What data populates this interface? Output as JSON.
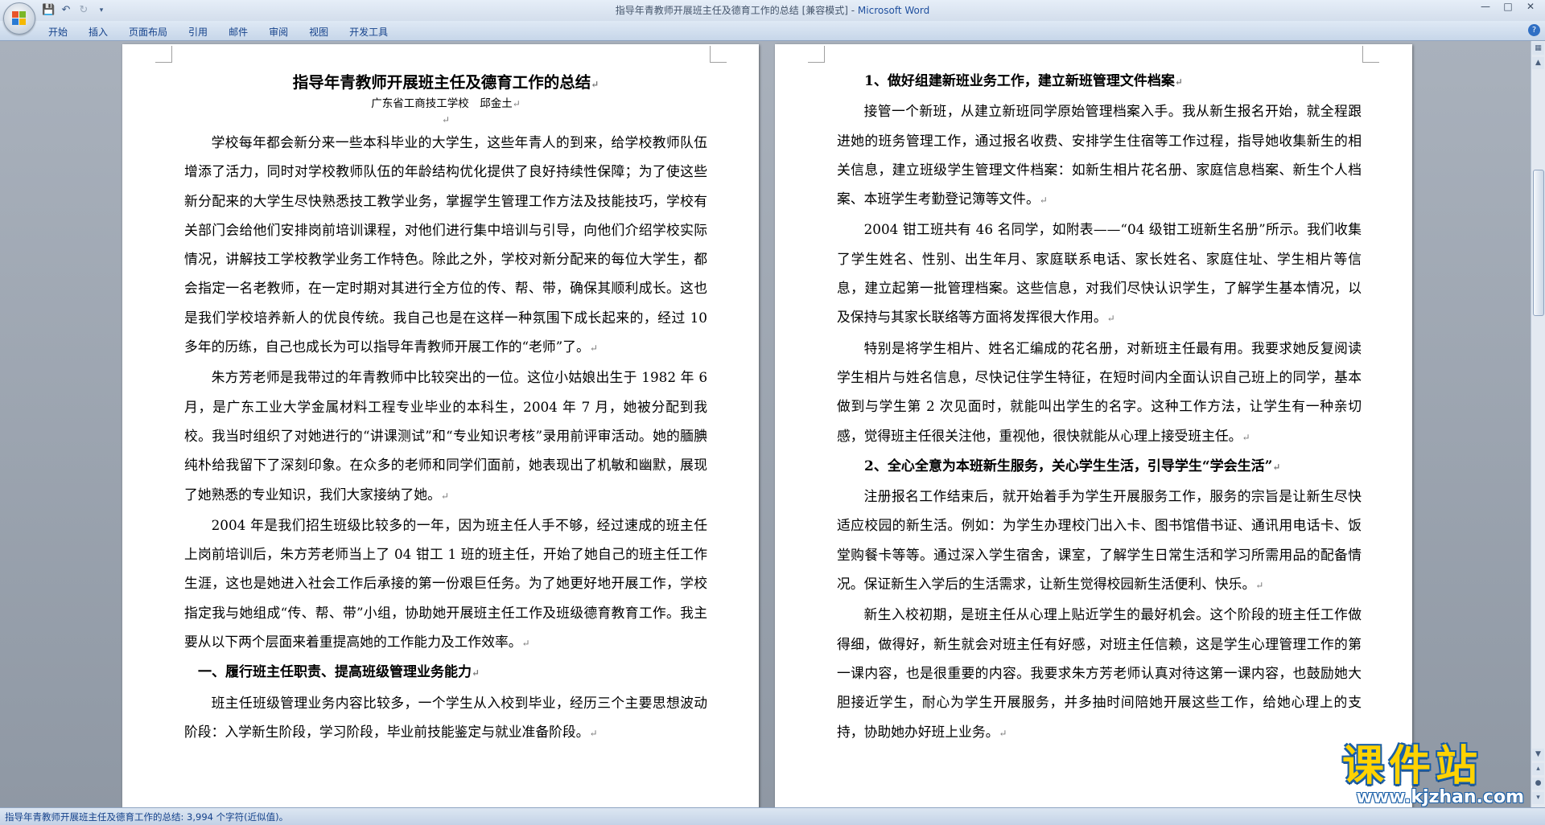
{
  "window": {
    "title": "指导年青教师开展班主任及德育工作的总结 [兼容模式] - ",
    "app_name": "Microsoft Word",
    "controls": [
      "—",
      "□",
      "✕"
    ]
  },
  "quick_access": [
    "save-icon",
    "undo-icon",
    "redo-icon",
    "customize-icon"
  ],
  "ribbon": {
    "tabs": [
      "开始",
      "插入",
      "页面布局",
      "引用",
      "邮件",
      "审阅",
      "视图",
      "开发工具"
    ]
  },
  "document": {
    "left_page": {
      "title": "指导年青教师开展班主任及德育工作的总结",
      "subtitle": "广东省工商技工学校　邱金土",
      "paragraphs": [
        {
          "type": "para",
          "text": "学校每年都会新分来一些本科毕业的大学生，这些年青人的到来，给学校教师队伍增添了活力，同时对学校教师队伍的年龄结构优化提供了良好持续性保障；为了使这些新分配来的大学生尽快熟悉技工教学业务，掌握学生管理工作方法及技能技巧，学校有关部门会给他们安排岗前培训课程，对他们进行集中培训与引导，向他们介绍学校实际情况，讲解技工学校教学业务工作特色。除此之外，学校对新分配来的每位大学生，都会指定一名老教师，在一定时期对其进行全方位的传、帮、带，确保其顺利成长。这也是我们学校培养新人的优良传统。我自己也是在这样一种氛围下成长起来的，经过 10 多年的历练，自己也成长为可以指导年青教师开展工作的“老师”了。"
        },
        {
          "type": "para",
          "text": "朱方芳老师是我带过的年青教师中比较突出的一位。这位小姑娘出生于 1982 年 6 月，是广东工业大学金属材料工程专业毕业的本科生，2004 年 7 月，她被分配到我校。我当时组织了对她进行的“讲课测试”和“专业知识考核”录用前评审活动。她的腼腆纯朴给我留下了深刻印象。在众多的老师和同学们面前，她表现出了机敏和幽默，展现了她熟悉的专业知识，我们大家接纳了她。"
        },
        {
          "type": "para",
          "text": "2004 年是我们招生班级比较多的一年，因为班主任人手不够，经过速成的班主任上岗前培训后，朱方芳老师当上了 04 钳工 1 班的班主任，开始了她自己的班主任工作生涯，这也是她进入社会工作后承接的第一份艰巨任务。为了她更好地开展工作，学校指定我与她组成“传、帮、带”小组，协助她开展班主任工作及班级德育教育工作。我主要从以下两个层面来着重提高她的工作能力及工作效率。"
        },
        {
          "type": "head",
          "text": "一、履行班主任职责、提高班级管理业务能力"
        },
        {
          "type": "para",
          "text": "班主任班级管理业务内容比较多，一个学生从入校到毕业，经历三个主要思想波动阶段：入学新生阶段，学习阶段，毕业前技能鉴定与就业准备阶段。"
        }
      ]
    },
    "right_page": {
      "paragraphs": [
        {
          "type": "head",
          "text": "1、做好组建新班业务工作，建立新班管理文件档案"
        },
        {
          "type": "para",
          "text": "接管一个新班，从建立新班同学原始管理档案入手。我从新生报名开始，就全程跟进她的班务管理工作，通过报名收费、安排学生住宿等工作过程，指导她收集新生的相关信息，建立班级学生管理文件档案：如新生相片花名册、家庭信息档案、新生个人档案、本班学生考勤登记簿等文件。"
        },
        {
          "type": "para",
          "text": "2004 钳工班共有 46 名同学，如附表——“04 级钳工班新生名册”所示。我们收集了学生姓名、性别、出生年月、家庭联系电话、家长姓名、家庭住址、学生相片等信息，建立起第一批管理档案。这些信息，对我们尽快认识学生，了解学生基本情况，以及保持与其家长联络等方面将发挥很大作用。"
        },
        {
          "type": "para",
          "text": "特别是将学生相片、姓名汇编成的花名册，对新班主任最有用。我要求她反复阅读学生相片与姓名信息，尽快记住学生特征，在短时间内全面认识自己班上的同学，基本做到与学生第 2 次见面时，就能叫出学生的名字。这种工作方法，让学生有一种亲切感，觉得班主任很关注他，重视他，很快就能从心理上接受班主任。"
        },
        {
          "type": "head",
          "text": "2、全心全意为本班新生服务，关心学生生活，引导学生“学会生活”"
        },
        {
          "type": "para",
          "text": "注册报名工作结束后，就开始着手为学生开展服务工作，服务的宗旨是让新生尽快适应校园的新生活。例如：为学生办理校门出入卡、图书馆借书证、通讯用电话卡、饭堂购餐卡等等。通过深入学生宿舍，课室，了解学生日常生活和学习所需用品的配备情况。保证新生入学后的生活需求，让新生觉得校园新生活便利、快乐。"
        },
        {
          "type": "para",
          "text": "新生入校初期，是班主任从心理上贴近学生的最好机会。这个阶段的班主任工作做得细，做得好，新生就会对班主任有好感，对班主任信赖，这是学生心理管理工作的第一课内容，也是很重要的内容。我要求朱方芳老师认真对待这第一课内容，也鼓励她大胆接近学生，耐心为学生开展服务，并多抽时间陪她开展这些工作，给她心理上的支持，协助她办好班上业务。"
        }
      ]
    }
  },
  "paragraph_mark": "↵",
  "statusbar": {
    "text": "指导年青教师开展班主任及德育工作的总结: 3,994 个字符(近似值)。"
  },
  "watermark": {
    "main": "课件站",
    "url": "www.kjzhan.com"
  }
}
